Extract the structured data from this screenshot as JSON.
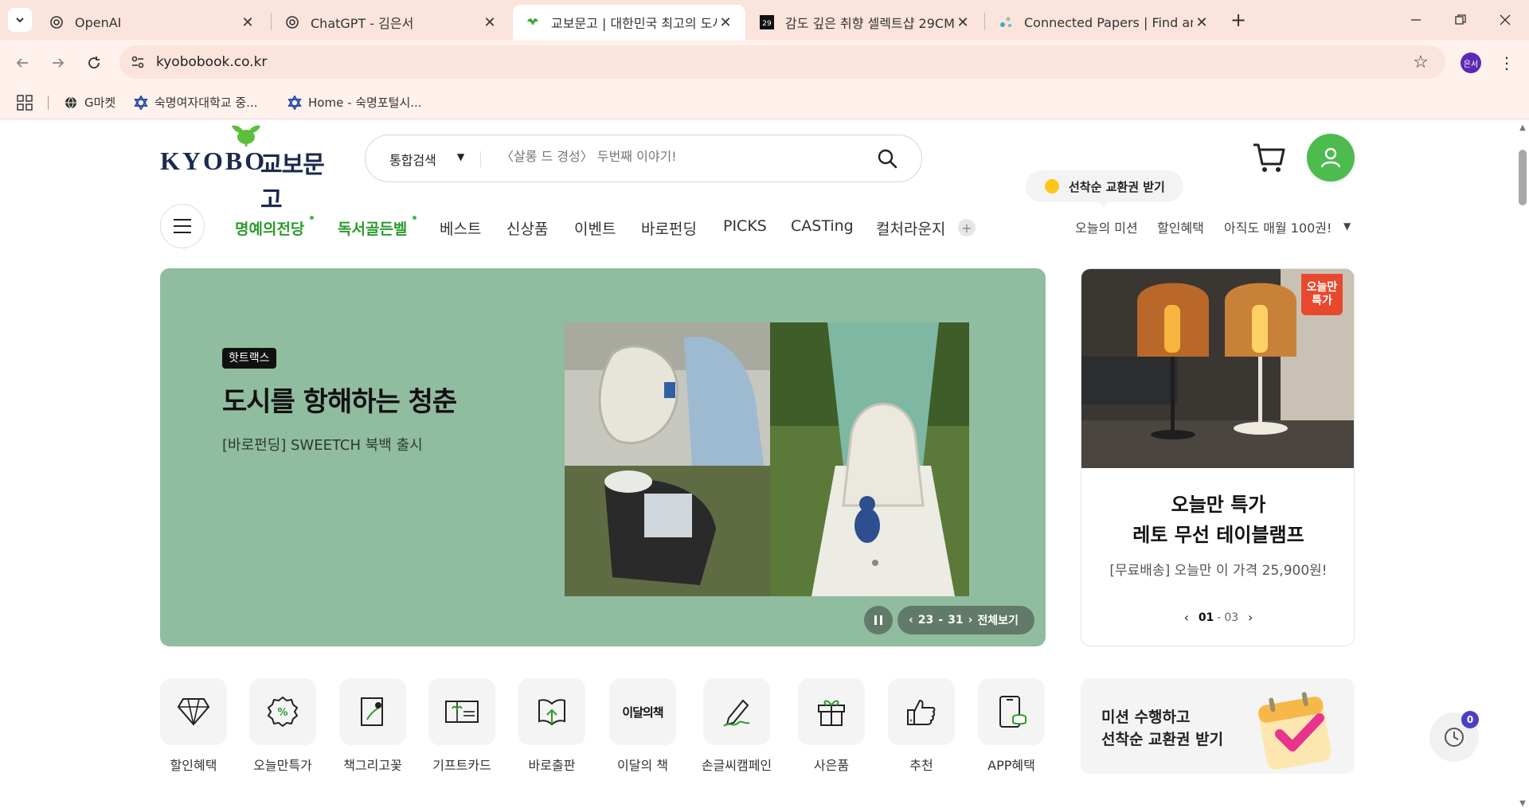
{
  "browser": {
    "tabs": [
      {
        "title": "OpenAI",
        "icon": "openai-icon",
        "active": false
      },
      {
        "title": "ChatGPT - 김은서",
        "icon": "openai-icon",
        "active": false
      },
      {
        "title": "교보문고 | 대한민국 최고의 도서",
        "icon": "kyobo-bird-icon",
        "active": true
      },
      {
        "title": "감도 깊은 취향 셀렉트샵 29CM",
        "icon": "29cm-icon",
        "active": false
      },
      {
        "title": "Connected Papers | Find and exp",
        "icon": "connected-papers-icon",
        "active": false
      }
    ],
    "url": "kyobobook.co.kr",
    "profile_initials": "은서",
    "bookmarks": [
      {
        "label": "G마켓",
        "icon": "globe-icon"
      },
      {
        "label": "숙명여자대학교 중...",
        "icon": "star-of-david-icon"
      },
      {
        "label": "Home - 숙명포털시...",
        "icon": "star-of-david-icon"
      }
    ]
  },
  "header": {
    "logo_en": "KYOBO",
    "logo_ko": "교보문고",
    "search_scope": "통합검색",
    "search_placeholder": "〈살롱 드 경성〉 두번째 이야기!",
    "coupon_bubble": "선착순 교환권 받기",
    "gnb": [
      {
        "label": "명예의전당",
        "green": true,
        "dot": true
      },
      {
        "label": "독서골든벨",
        "green": true,
        "dot": true
      },
      {
        "label": "베스트",
        "green": false,
        "dot": false
      },
      {
        "label": "신상품",
        "green": false,
        "dot": false
      },
      {
        "label": "이벤트",
        "green": false,
        "dot": false
      },
      {
        "label": "바로펀딩",
        "green": false,
        "dot": false
      },
      {
        "label": "PICKS",
        "green": false,
        "dot": false
      },
      {
        "label": "CASTing",
        "green": false,
        "dot": false
      },
      {
        "label": "컬처라운지",
        "green": false,
        "dot": false
      }
    ],
    "gnb_more": "+",
    "util": [
      "오늘의 미션",
      "할인혜택",
      "아직도 매월 100권!"
    ]
  },
  "hero": {
    "badge": "핫트랙스",
    "headline": "도시를 항해하는 청춘",
    "sub": "[바로펀딩] SWEETCH 북백 출시",
    "pager_current": "23",
    "pager_sep": "-",
    "pager_total": "31",
    "view_all": "전체보기",
    "bg_color": "#90bca0"
  },
  "side_card": {
    "flag_line1": "오늘만",
    "flag_line2": "특가",
    "title1": "오늘만 특가",
    "title2": "레토 무선 테이블램프",
    "desc": "[무료배송] 오늘만 이 가격 25,900원!",
    "page_current": "01",
    "page_sep": "-",
    "page_total": "03"
  },
  "quick_menu": [
    {
      "label": "할인혜택",
      "icon": "diamond-icon"
    },
    {
      "label": "오늘만특가",
      "icon": "percent-badge-icon"
    },
    {
      "label": "책그리고꽃",
      "icon": "book-flower-icon"
    },
    {
      "label": "기프트카드",
      "icon": "gift-card-icon"
    },
    {
      "label": "바로출판",
      "icon": "book-upload-icon"
    },
    {
      "label": "이달의 책",
      "icon": "month-book-icon",
      "icon_text": "이달의책"
    },
    {
      "label": "손글씨캠페인",
      "icon": "pen-icon"
    },
    {
      "label": "사은품",
      "icon": "gift-box-icon"
    },
    {
      "label": "추천",
      "icon": "thumbs-up-icon"
    },
    {
      "label": "APP혜택",
      "icon": "mobile-coin-icon"
    }
  ],
  "mission_banner": {
    "line1": "미션 수행하고",
    "line2": "선착순 교환권 받기"
  },
  "recent": {
    "count": "0"
  },
  "colors": {
    "brand_green": "#4dbb4e",
    "nav_green": "#2d9b2e",
    "navy": "#1b2a4e",
    "sale_red": "#e8492e"
  }
}
